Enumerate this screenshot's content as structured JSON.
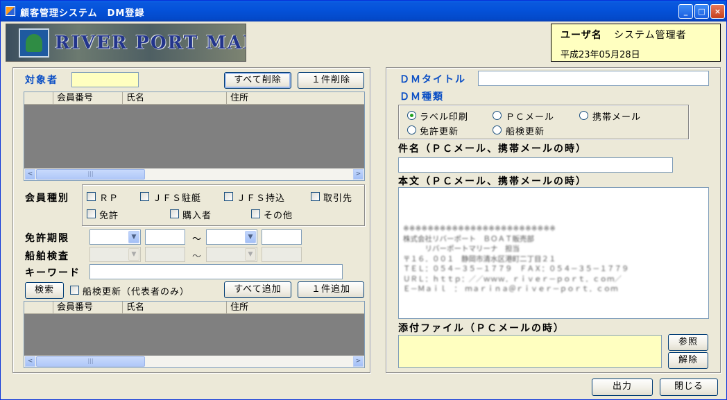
{
  "window": {
    "title": "顧客管理システム　DM登録",
    "minimize_glyph": "_",
    "maximize_glyph": "□",
    "close_glyph": "×"
  },
  "logo": {
    "text": "RIVER PORT MARINA"
  },
  "user": {
    "label": "ユーザ名",
    "name": "システム管理者",
    "date": "平成23年05月28日"
  },
  "left": {
    "target_label": "対象者",
    "target_value": "",
    "delete_all_label": "すべて削除",
    "delete_one_label": "１件削除",
    "grid_top": {
      "columns": [
        "会員番号",
        "氏名",
        "住所"
      ],
      "rows": []
    },
    "member_type_label": "会員種別",
    "member_types": [
      "ＲＰ",
      "ＪＦＳ駐艇",
      "ＪＦＳ持込",
      "取引先",
      "免許",
      "購入者",
      "その他"
    ],
    "license_period_label": "免許期限",
    "ship_inspection_label": "船舶検査",
    "range_separator": "～",
    "keyword_label": "キーワード",
    "keyword_value": "",
    "search_label": "検索",
    "ship_renewal_rep_label": "船検更新（代表者のみ）",
    "add_all_label": "すべて追加",
    "add_one_label": "１件追加",
    "grid_bottom": {
      "columns": [
        "会員番号",
        "氏名",
        "住所"
      ],
      "rows": []
    },
    "scroll_thumb_glyph": "|||",
    "scroll_left_glyph": "<",
    "scroll_right_glyph": ">",
    "combo_arrow_glyph": "▼"
  },
  "right": {
    "dm_title_label": "ＤＭタイトル",
    "dm_title_value": "",
    "dm_type_label": "ＤＭ種類",
    "dm_types": [
      {
        "label": "ラベル印刷",
        "selected": true
      },
      {
        "label": "ＰＣメール",
        "selected": false
      },
      {
        "label": "携帯メール",
        "selected": false
      },
      {
        "label": "免許更新",
        "selected": false
      },
      {
        "label": "船検更新",
        "selected": false
      }
    ],
    "subject_label": "件名（ＰＣメール、携帯メールの時）",
    "subject_value": "",
    "body_label": "本文（ＰＣメール、携帯メールの時）",
    "body_signature": "※※※※※※※※※※※※※※※※※※※※※※※※※\n株式会社リバーポート　ＢＯＡＴ販売部\n　　　リバーポートマリーナ　担当\n〒１６．００１　静岡市清水区港町二丁目２１\nＴＥＬ：０５４－３５－１７７９　ＦＡＸ：０５４－３５－１７７９\nＵＲＬ：ｈｔｔｐ：／／ｗｗｗ．ｒｉｖｅｒ－ｐｏｒｔ．ｃｏｍ／\nＥ－Ｍａｉｌ　：　ｍａｒｉｎａ＠ｒｉｖｅｒ－ｐｏｒｔ．ｃｏｍ",
    "attachment_label": "添付ファイル（ＰＣメールの時）",
    "attachment_value": "",
    "browse_label": "参照",
    "clear_label": "解除"
  },
  "footer": {
    "output_label": "出力",
    "close_label": "閉じる"
  }
}
